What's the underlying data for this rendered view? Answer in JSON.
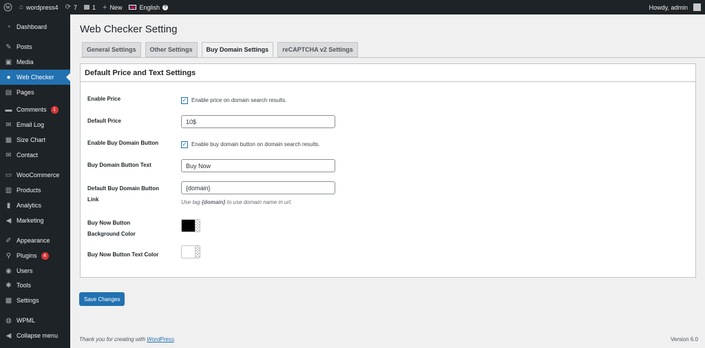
{
  "adminbar": {
    "site_name": "wordpress4",
    "updates_count": "7",
    "comments_count": "1",
    "new_label": "New",
    "language": "English",
    "greeting": "Howdy, admin"
  },
  "sidebar": {
    "items": [
      {
        "label": "Dashboard",
        "icon": "dashboard-icon"
      },
      {
        "label": "Posts",
        "icon": "pushpin-icon"
      },
      {
        "label": "Media",
        "icon": "media-icon"
      },
      {
        "label": "Web Checker",
        "icon": "globe-icon",
        "current": true
      },
      {
        "label": "Pages",
        "icon": "pages-icon"
      },
      {
        "label": "Comments",
        "icon": "comment-icon",
        "badge": "1"
      },
      {
        "label": "Email Log",
        "icon": "email-icon"
      },
      {
        "label": "Size Chart",
        "icon": "chart-icon"
      },
      {
        "label": "Contact",
        "icon": "envelope-icon"
      },
      {
        "label": "WooCommerce",
        "icon": "woocommerce-icon"
      },
      {
        "label": "Products",
        "icon": "products-icon"
      },
      {
        "label": "Analytics",
        "icon": "analytics-icon"
      },
      {
        "label": "Marketing",
        "icon": "megaphone-icon"
      },
      {
        "label": "Appearance",
        "icon": "brush-icon"
      },
      {
        "label": "Plugins",
        "icon": "plugin-icon",
        "badge": "4"
      },
      {
        "label": "Users",
        "icon": "users-icon"
      },
      {
        "label": "Tools",
        "icon": "wrench-icon"
      },
      {
        "label": "Settings",
        "icon": "settings-icon"
      },
      {
        "label": "WPML",
        "icon": "wpml-icon"
      },
      {
        "label": "Collapse menu",
        "icon": "collapse-icon"
      }
    ]
  },
  "page": {
    "title": "Web Checker Setting",
    "tabs": [
      {
        "label": "General Settings"
      },
      {
        "label": "Other Settings"
      },
      {
        "label": "Buy Domain Settings",
        "active": true
      },
      {
        "label": "reCAPTCHA v2 Settings"
      }
    ],
    "panel_title": "Default Price and Text Settings"
  },
  "form": {
    "enable_price": {
      "label": "Enable Price",
      "checkbox_label": "Enable price on domain search results.",
      "checked": true
    },
    "default_price": {
      "label": "Default Price",
      "value": "10$"
    },
    "enable_buy_button": {
      "label": "Enable Buy Domain Button",
      "checkbox_label": "Enable buy domain button on domain search results.",
      "checked": true
    },
    "buy_button_text": {
      "label": "Buy Domain Button Text",
      "value": "Buy Now"
    },
    "buy_button_link": {
      "label_line1": "Default Buy Domain Button",
      "label_line2": "Link",
      "value": "{domain}",
      "desc_pre": "Use tag",
      "desc_tag": "{domain}",
      "desc_post": "to use domain name in url."
    },
    "bg_color": {
      "label_line1": "Buy Now Button",
      "label_line2": "Background Color",
      "color": "#000000"
    },
    "text_color": {
      "label": "Buy Now Button Text Color",
      "color": "#ffffff"
    }
  },
  "save_label": "Save Changes",
  "footer": {
    "text_pre": "Thank you for creating with",
    "link": "WordPress",
    "text_post": ".",
    "version": "Version 6.0"
  },
  "colors": {
    "accent": "#2271b1",
    "sidebar_bg": "#1d2327",
    "badge": "#d63638"
  }
}
